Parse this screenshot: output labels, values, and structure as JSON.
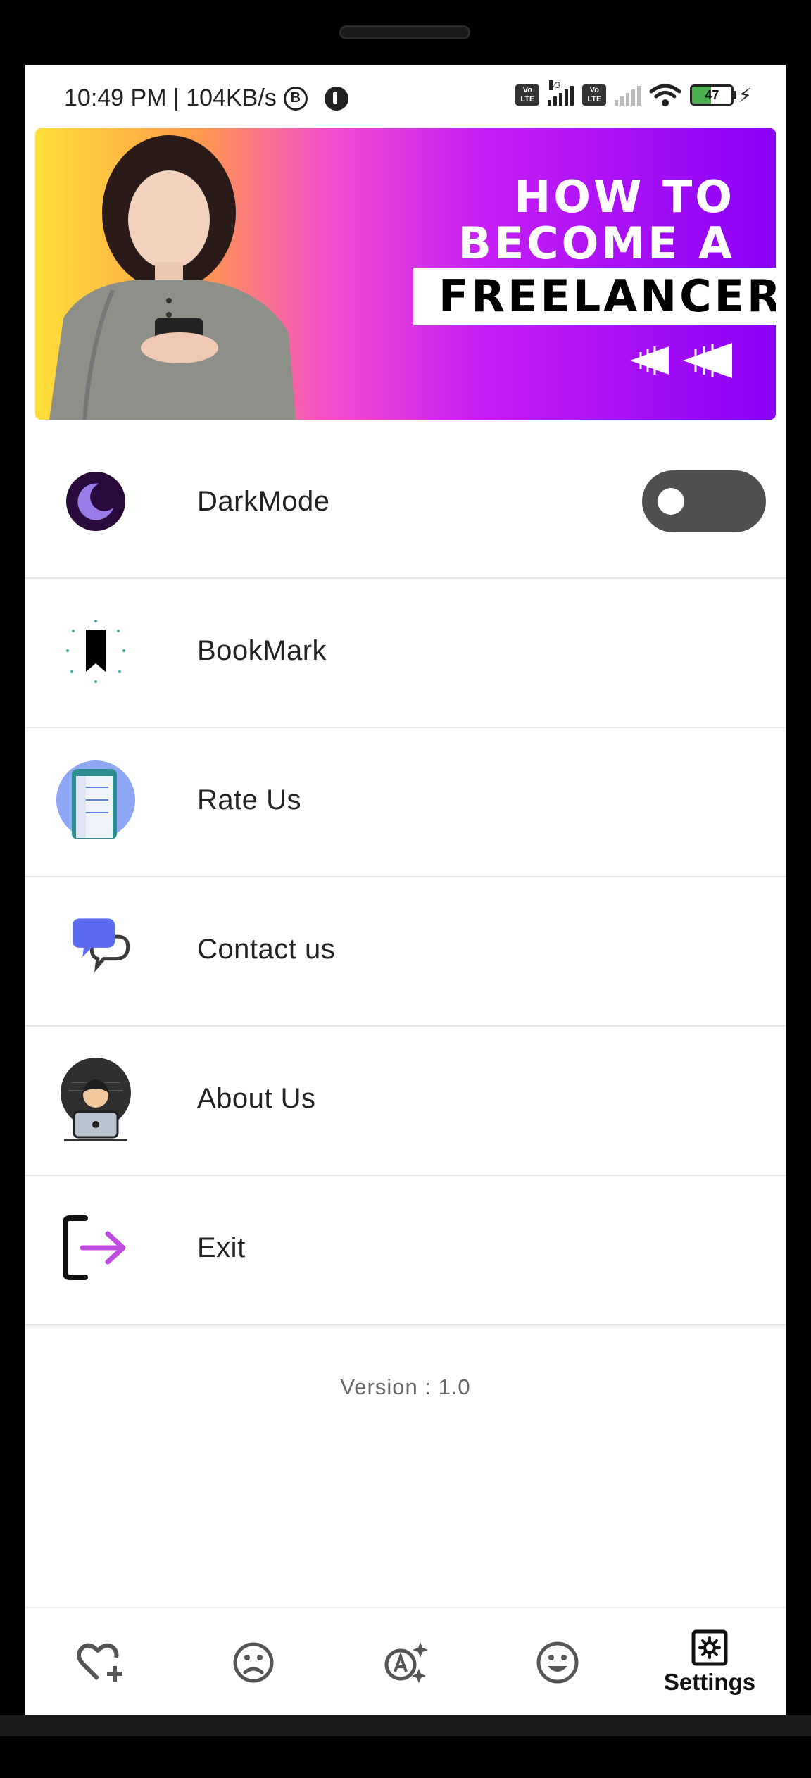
{
  "status_bar": {
    "time_speed": "10:49 PM | 104KB/s",
    "b_icon": "B",
    "volte": "Vo LTE",
    "network_type": "4G",
    "battery": "47"
  },
  "banner": {
    "line1": "HOW TO",
    "line2": "BECOME A",
    "line3": "FREELANCER"
  },
  "settings": {
    "items": [
      {
        "label": "DarkMode",
        "icon": "moon-icon"
      },
      {
        "label": "BookMark",
        "icon": "bookmark-icon"
      },
      {
        "label": "Rate Us",
        "icon": "rate-phone-icon"
      },
      {
        "label": "Contact us",
        "icon": "chat-bubbles-icon"
      },
      {
        "label": "About Us",
        "icon": "developer-avatar-icon"
      },
      {
        "label": "Exit",
        "icon": "exit-arrow-icon"
      }
    ],
    "darkmode_on": false
  },
  "version": "Version : 1.0",
  "bottom_nav": {
    "items": [
      {
        "icon": "heart-plus-icon"
      },
      {
        "icon": "sad-face-icon"
      },
      {
        "icon": "text-sparkle-icon"
      },
      {
        "icon": "happy-face-icon"
      },
      {
        "icon": "settings-icon",
        "label": "Settings"
      }
    ],
    "active": "Settings"
  },
  "colors": {
    "banner_start": "#ffe03a",
    "banner_end": "#8a00f5",
    "moon_bg": "#2a0a3d",
    "moon": "#9b7be8",
    "chat": "#5b6cf0",
    "exit_arrow": "#c04be0",
    "toggle_track": "#4f4f4f"
  }
}
